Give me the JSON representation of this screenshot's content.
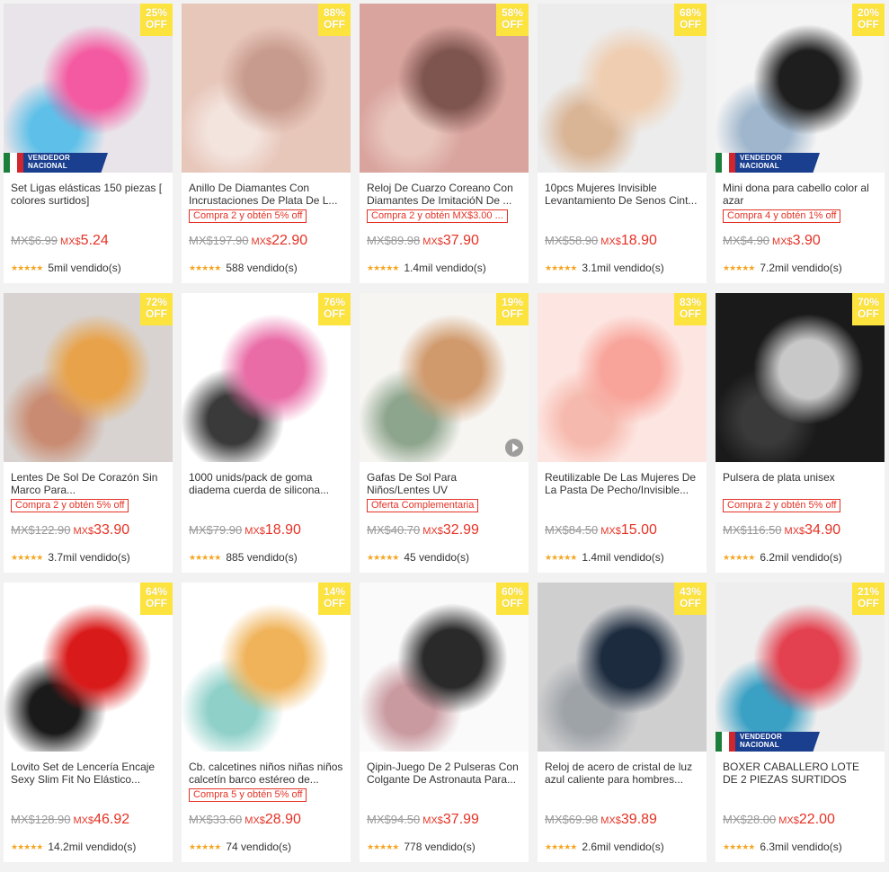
{
  "products": [
    {
      "title": "Set Ligas elásticas 150 piezas [ colores surtidos]",
      "discount": "25%",
      "off_label": "OFF",
      "vendor_label": "VENDEDOR NACIONAL",
      "promo": "",
      "old_price": "MX$6.99",
      "currency": "MX$",
      "price": "5.24",
      "sold": "5mil vendido(s)",
      "image_colors": [
        "#e9e4ea",
        "#f45aa1",
        "#5ec0e8"
      ],
      "video": false
    },
    {
      "title": "Anillo De Diamantes Con Incrustaciones De Plata De L...",
      "discount": "88%",
      "off_label": "OFF",
      "vendor_label": "",
      "promo": "Compra 2 y obtén 5% off",
      "old_price": "MX$197.90",
      "currency": "MX$",
      "price": "22.90",
      "sold": "588 vendido(s)",
      "image_colors": [
        "#e8c7bb",
        "#c79b8d",
        "#f3e4de"
      ],
      "video": false
    },
    {
      "title": "Reloj De Cuarzo Coreano Con Diamantes De ImitacióN De ...",
      "discount": "58%",
      "off_label": "OFF",
      "vendor_label": "",
      "promo": "Compra 2 y obtén MX$3.00 ...",
      "old_price": "MX$89.98",
      "currency": "MX$",
      "price": "37.90",
      "sold": "1.4mil vendido(s)",
      "image_colors": [
        "#d9a49e",
        "#7f5550",
        "#e8c6bd"
      ],
      "video": false
    },
    {
      "title": "10pcs Mujeres Invisible Levantamiento De Senos Cint...",
      "discount": "68%",
      "off_label": "OFF",
      "vendor_label": "",
      "promo": "",
      "old_price": "MX$58.90",
      "currency": "MX$",
      "price": "18.90",
      "sold": "3.1mil vendido(s)",
      "image_colors": [
        "#ececec",
        "#efcdb0",
        "#d9b596"
      ],
      "video": false
    },
    {
      "title": "Mini dona para cabello color al azar",
      "discount": "20%",
      "off_label": "OFF",
      "vendor_label": "VENDEDOR NACIONAL",
      "promo": "Compra 4 y obtén 1% off",
      "old_price": "MX$4.90",
      "currency": "MX$",
      "price": "3.90",
      "sold": "7.2mil vendido(s)",
      "image_colors": [
        "#f4f4f4",
        "#1e1e1e",
        "#9fb6cc"
      ],
      "video": false
    },
    {
      "title": "Lentes De Sol De Corazón Sin Marco Para...",
      "discount": "72%",
      "off_label": "OFF",
      "vendor_label": "",
      "promo": "Compra 2 y obtén 5% off",
      "old_price": "MX$122.90",
      "currency": "MX$",
      "price": "33.90",
      "sold": "3.7mil vendido(s)",
      "image_colors": [
        "#d8d3d0",
        "#e8a24a",
        "#c98c72"
      ],
      "video": false
    },
    {
      "title": "1000 unids/pack de goma diadema cuerda de silicona...",
      "discount": "76%",
      "off_label": "OFF",
      "vendor_label": "",
      "promo": "",
      "old_price": "MX$79.90",
      "currency": "MX$",
      "price": "18.90",
      "sold": "885 vendido(s)",
      "image_colors": [
        "#ffffff",
        "#e96ca7",
        "#3a3a3a"
      ],
      "video": false
    },
    {
      "title": "Gafas De Sol Para Niños/Lentes UV",
      "discount": "19%",
      "off_label": "OFF",
      "vendor_label": "",
      "promo": "Oferta Complementaria",
      "old_price": "MX$40.70",
      "currency": "MX$",
      "price": "32.99",
      "sold": "45 vendido(s)",
      "image_colors": [
        "#f7f5f2",
        "#d09a6d",
        "#8ea58d"
      ],
      "video": true
    },
    {
      "title": "Reutilizable De Las Mujeres De La Pasta De Pecho/Invisible...",
      "discount": "83%",
      "off_label": "OFF",
      "vendor_label": "",
      "promo": "",
      "old_price": "MX$84.50",
      "currency": "MX$",
      "price": "15.00",
      "sold": "1.4mil vendido(s)",
      "image_colors": [
        "#fde6e2",
        "#f8a49a",
        "#f6b9ad"
      ],
      "video": false
    },
    {
      "title": "Pulsera de plata unisex",
      "discount": "70%",
      "off_label": "OFF",
      "vendor_label": "",
      "promo": "Compra 2 y obtén 5% off",
      "old_price": "MX$116.50",
      "currency": "MX$",
      "price": "34.90",
      "sold": "6.2mil vendido(s)",
      "image_colors": [
        "#1a1a1a",
        "#c8c8c8",
        "#3a3a3a"
      ],
      "video": false
    },
    {
      "title": "Lovito Set de Lencería Encaje Sexy Slim Fit No Elástico...",
      "discount": "64%",
      "off_label": "OFF",
      "vendor_label": "",
      "promo": "",
      "old_price": "MX$128.90",
      "currency": "MX$",
      "price": "46.92",
      "sold": "14.2mil vendido(s)",
      "image_colors": [
        "#ffffff",
        "#d91a1a",
        "#1a1a1a"
      ],
      "video": false
    },
    {
      "title": "Cb. calcetines niños niñas niños calcetín barco estéreo de...",
      "discount": "14%",
      "off_label": "OFF",
      "vendor_label": "",
      "promo": "Compra 5 y obtén 5% off",
      "old_price": "MX$33.60",
      "currency": "MX$",
      "price": "28.90",
      "sold": "74 vendido(s)",
      "image_colors": [
        "#ffffff",
        "#f0b35a",
        "#8fd0c9"
      ],
      "video": false
    },
    {
      "title": "Qipin-Juego De 2 Pulseras Con Colgante De Astronauta Para...",
      "discount": "60%",
      "off_label": "OFF",
      "vendor_label": "",
      "promo": "",
      "old_price": "MX$94.50",
      "currency": "MX$",
      "price": "37.99",
      "sold": "778 vendido(s)",
      "image_colors": [
        "#fafafa",
        "#2a2a2a",
        "#c99aa0"
      ],
      "video": false
    },
    {
      "title": "Reloj de acero de cristal de luz azul caliente para hombres...",
      "discount": "43%",
      "off_label": "OFF",
      "vendor_label": "",
      "promo": "",
      "old_price": "MX$69.98",
      "currency": "MX$",
      "price": "39.89",
      "sold": "2.6mil vendido(s)",
      "image_colors": [
        "#cfcfd0",
        "#1c2b3e",
        "#9ea3a8"
      ],
      "video": false
    },
    {
      "title": "BOXER CABALLERO LOTE DE 2 PIEZAS SURTIDOS",
      "discount": "21%",
      "off_label": "OFF",
      "vendor_label": "VENDEDOR NACIONAL",
      "promo": "",
      "old_price": "MX$28.00",
      "currency": "MX$",
      "price": "22.00",
      "sold": "6.3mil vendido(s)",
      "image_colors": [
        "#eeeeee",
        "#e3414f",
        "#3aa0c4"
      ],
      "video": false
    }
  ],
  "flag_colors": [
    "#1b7f3c",
    "#ffffff",
    "#d2262e"
  ]
}
